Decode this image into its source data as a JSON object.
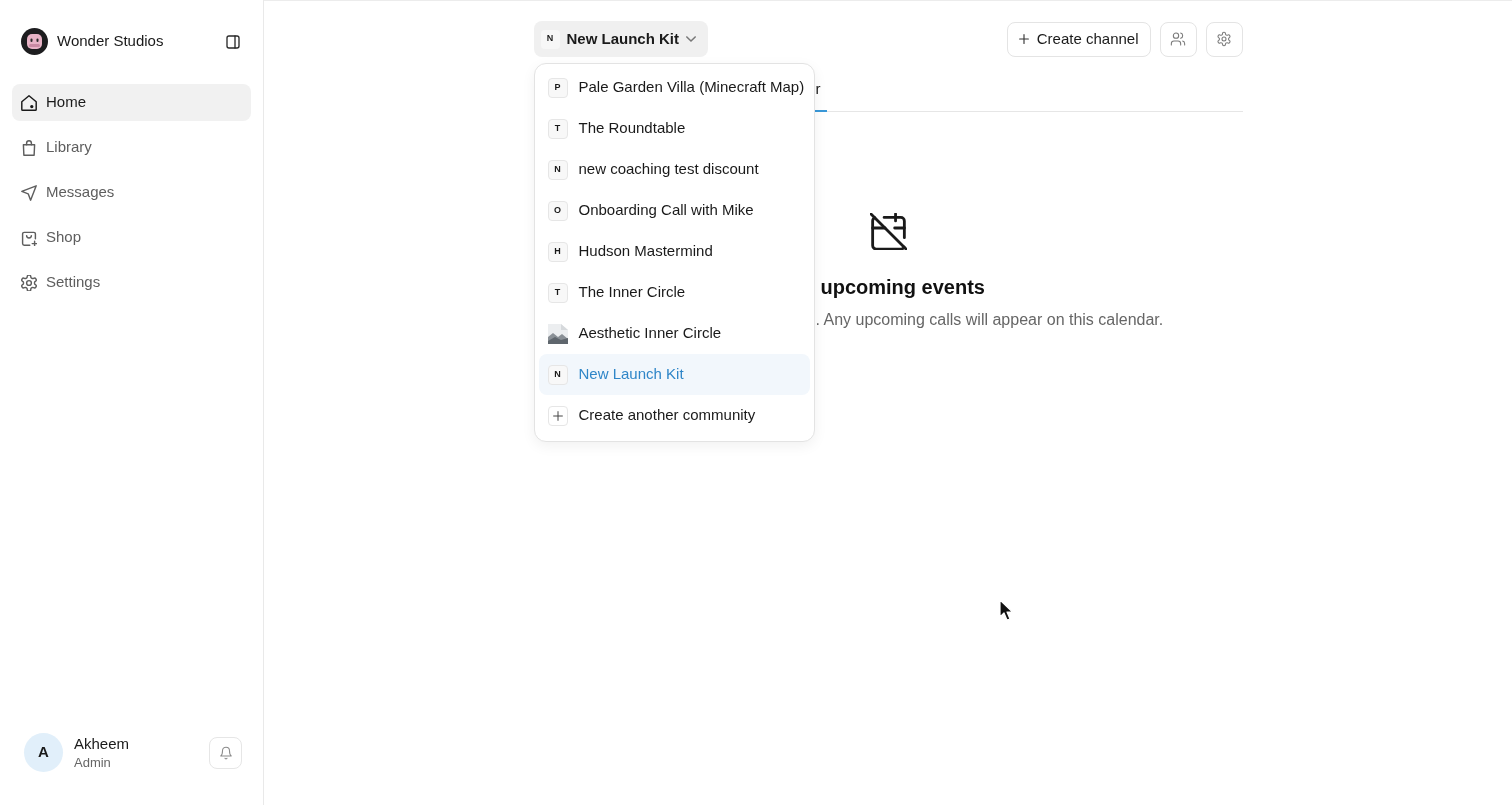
{
  "sidebar": {
    "workspace_name": "Wonder Studios",
    "nav": [
      {
        "label": "Home",
        "selected": true
      },
      {
        "label": "Library",
        "selected": false
      },
      {
        "label": "Messages",
        "selected": false
      },
      {
        "label": "Shop",
        "selected": false
      },
      {
        "label": "Settings",
        "selected": false
      }
    ],
    "user": {
      "initial": "A",
      "name": "Akheem",
      "role": "Admin"
    }
  },
  "header": {
    "community_switcher": {
      "initial": "N",
      "label": "New Launch Kit"
    },
    "create_button": "Create channel"
  },
  "community_menu": [
    {
      "kind": "letter",
      "initial": "P",
      "label": "Pale Garden Villa (Minecraft Map)",
      "selected": false
    },
    {
      "kind": "letter",
      "initial": "T",
      "label": "The Roundtable",
      "selected": false
    },
    {
      "kind": "letter",
      "initial": "N",
      "label": "new coaching test discount",
      "selected": false
    },
    {
      "kind": "letter",
      "initial": "O",
      "label": "Onboarding Call with Mike",
      "selected": false
    },
    {
      "kind": "letter",
      "initial": "H",
      "label": "Hudson Mastermind",
      "selected": false
    },
    {
      "kind": "letter",
      "initial": "T",
      "label": "The Inner Circle",
      "selected": false
    },
    {
      "kind": "image",
      "label": "Aesthetic Inner Circle",
      "selected": false
    },
    {
      "kind": "letter",
      "initial": "N",
      "label": "New Launch Kit",
      "selected": true
    },
    {
      "kind": "create",
      "label": "Create another community",
      "selected": false
    }
  ],
  "tabs": [
    {
      "label": "r",
      "selected": true
    }
  ],
  "empty_state": {
    "title": "upcoming events",
    "message": ". Any upcoming calls will appear on this calendar."
  }
}
